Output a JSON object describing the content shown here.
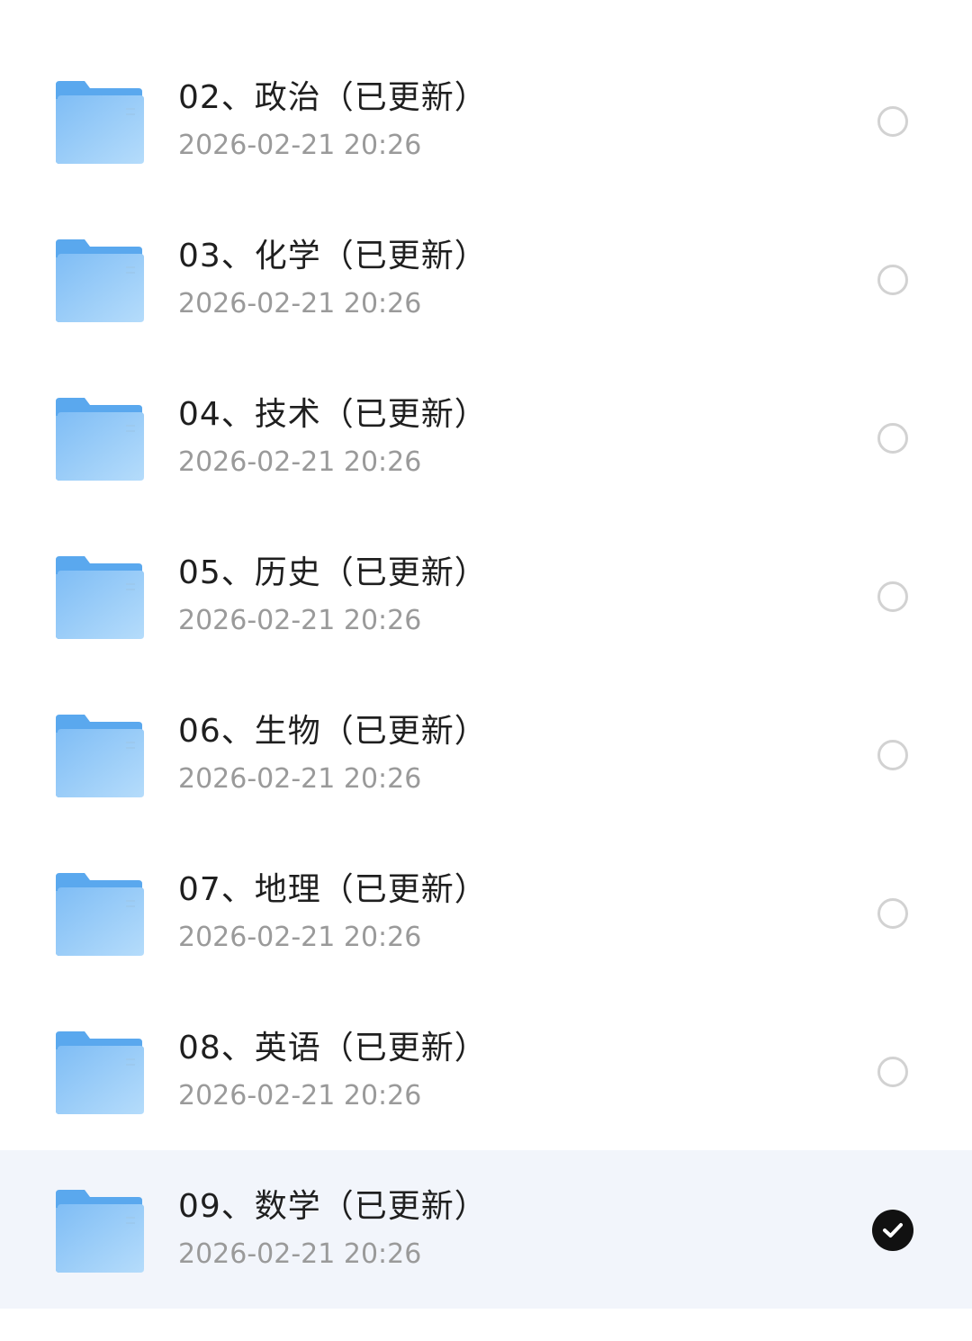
{
  "files": [
    {
      "name": "02、政治（已更新）",
      "date": "2026-02-21 20:26",
      "selected": false
    },
    {
      "name": "03、化学（已更新）",
      "date": "2026-02-21 20:26",
      "selected": false
    },
    {
      "name": "04、技术（已更新）",
      "date": "2026-02-21 20:26",
      "selected": false
    },
    {
      "name": "05、历史（已更新）",
      "date": "2026-02-21 20:26",
      "selected": false
    },
    {
      "name": "06、生物（已更新）",
      "date": "2026-02-21 20:26",
      "selected": false
    },
    {
      "name": "07、地理（已更新）",
      "date": "2026-02-21 20:26",
      "selected": false
    },
    {
      "name": "08、英语（已更新）",
      "date": "2026-02-21 20:26",
      "selected": false
    },
    {
      "name": "09、数学（已更新）",
      "date": "2026-02-21 20:26",
      "selected": true
    }
  ],
  "icons": {
    "folder": "folder-icon",
    "unchecked": "radio-unchecked-icon",
    "checked": "checkmark-icon"
  },
  "colors": {
    "folder_light": "#8cc6f7",
    "folder_dark": "#5aa8ee",
    "selected_row_bg": "#f2f5fb",
    "check_fill": "#111111"
  }
}
